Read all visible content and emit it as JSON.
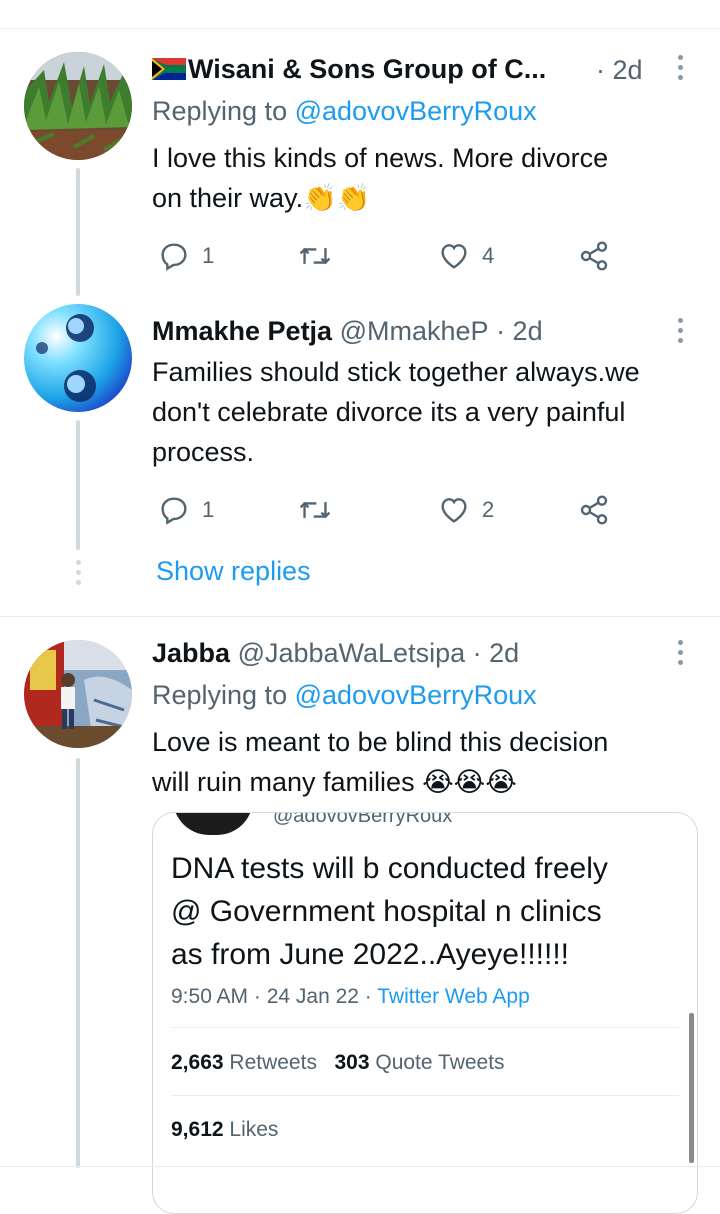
{
  "tweets": [
    {
      "name": "Wisani & Sons Group of C...",
      "flag": "🇿🇦",
      "time": "· 2d",
      "replying_prefix": "Replying to ",
      "replying_handle": "@adovovBerryRoux",
      "text_line1": "I love this kinds of news. More divorce",
      "text_line2": "on their way.",
      "emoji": "👏👏",
      "reply_count": "1",
      "like_count": "4"
    },
    {
      "name": "Mmakhe Petja",
      "handle": "@MmakheP",
      "time": "· 2d",
      "text_line1": "Families should stick together always.we",
      "text_line2": "don't celebrate divorce its a very painful",
      "text_line3": "process.",
      "reply_count": "1",
      "like_count": "2"
    },
    {
      "name": "Jabba",
      "handle": "@JabbaWaLetsipa",
      "time": "· 2d",
      "replying_prefix": "Replying to ",
      "replying_handle": "@adovovBerryRoux",
      "text_line1": "Love is meant to be blind this decision",
      "text_line2": "will ruin many families",
      "emoji": "😭😭😭"
    }
  ],
  "show_replies": "Show replies",
  "quote": {
    "handle_cut": "@adovovBerryRoux",
    "line1": "DNA tests will b conducted freely",
    "line2": "@ Government hospital n clinics",
    "line3": "as from June 2022..Ayeye!!!!!!",
    "meta_time": "9:50 AM · 24 Jan 22 · ",
    "meta_app": "Twitter Web App",
    "retweets_count": "2,663",
    "retweets_label": "Retweets",
    "quotes_count": "303",
    "quotes_label": "Quote Tweets",
    "likes_count": "9,612",
    "likes_label": "Likes"
  },
  "colors": {
    "accent": "#1d9bf0",
    "muted": "#536471",
    "text": "#0f1419"
  }
}
